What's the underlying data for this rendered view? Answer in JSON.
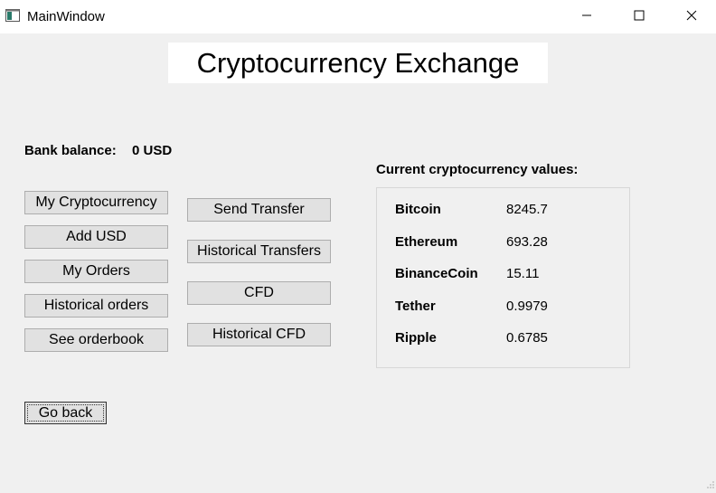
{
  "window": {
    "title": "MainWindow",
    "icon": "app-window-icon",
    "controls": [
      "minimize-icon",
      "maximize-icon",
      "close-icon"
    ]
  },
  "header": {
    "title": "Cryptocurrency Exchange"
  },
  "bank": {
    "label": "Bank balance:",
    "value": "0 USD"
  },
  "left_buttons": [
    {
      "label": "My Cryptocurrency"
    },
    {
      "label": "Add USD"
    },
    {
      "label": "My Orders"
    },
    {
      "label": "Historical orders"
    },
    {
      "label": "See orderbook"
    }
  ],
  "right_buttons": [
    {
      "label": "Send Transfer"
    },
    {
      "label": "Historical Transfers"
    },
    {
      "label": "CFD"
    },
    {
      "label": "Historical CFD"
    }
  ],
  "values": {
    "heading": "Current cryptocurrency values:",
    "items": [
      {
        "name": "Bitcoin",
        "value": "8245.7"
      },
      {
        "name": "Ethereum",
        "value": "693.28"
      },
      {
        "name": "BinanceCoin",
        "value": "15.11"
      },
      {
        "name": "Tether",
        "value": "0.9979"
      },
      {
        "name": "Ripple",
        "value": "0.6785"
      }
    ]
  },
  "footer": {
    "go_back_label": "Go back"
  }
}
